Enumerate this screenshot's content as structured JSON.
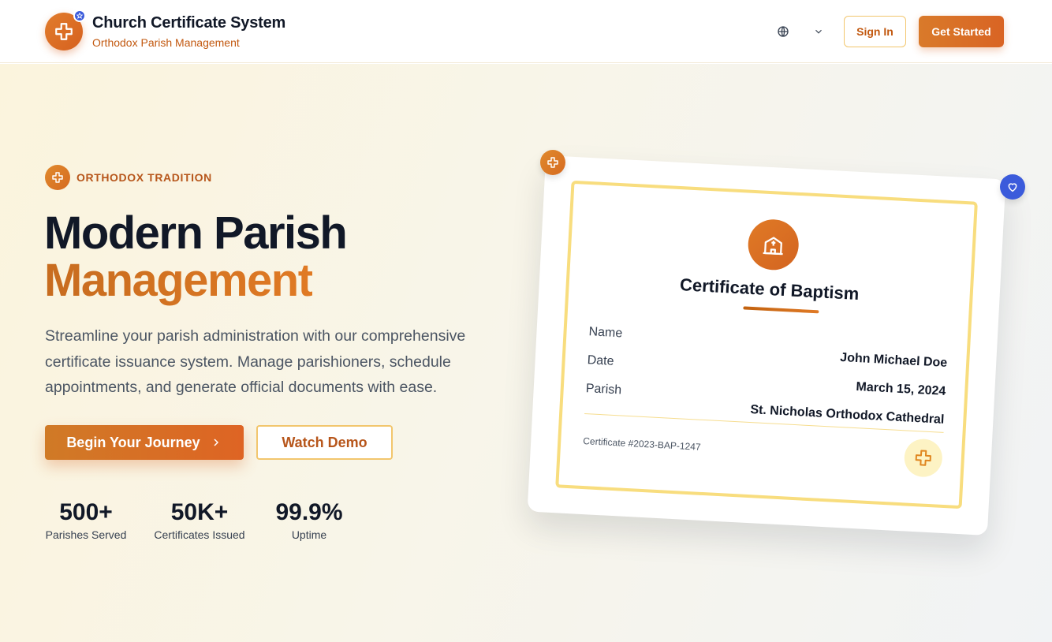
{
  "header": {
    "brand_title": "Church Certificate System",
    "brand_subtitle": "Orthodox Parish Management",
    "sign_in_label": "Sign In",
    "get_started_label": "Get Started"
  },
  "hero": {
    "tag": "ORTHODOX TRADITION",
    "title_line1": "Modern Parish",
    "title_line2": "Management",
    "description": "Streamline your parish administration with our comprehensive certificate issuance system. Manage parishioners, schedule appointments, and generate official documents with ease.",
    "primary_cta": "Begin Your Journey",
    "secondary_cta": "Watch Demo",
    "stats": [
      {
        "value": "500+",
        "label": "Parishes Served"
      },
      {
        "value": "50K+",
        "label": "Certificates Issued"
      },
      {
        "value": "99.9%",
        "label": "Uptime"
      }
    ]
  },
  "certificate": {
    "title": "Certificate of Baptism",
    "fields": [
      {
        "label": "Name",
        "value": "John Michael Doe"
      },
      {
        "label": "Date",
        "value": "March 15, 2024"
      },
      {
        "label": "Parish",
        "value": "St. Nicholas Orthodox Cathedral"
      }
    ],
    "number": "Certificate #2023-BAP-1247"
  },
  "colors": {
    "accent": "#d96424",
    "accent_light": "#f2c66d",
    "badge_blue": "#3b5bdb",
    "heading": "#111827"
  },
  "icons": {
    "logo": "cross-icon",
    "logo_badge": "star-icon",
    "language": "globe-icon",
    "language_dropdown": "chevron-down-icon",
    "cta_arrow": "chevron-right-icon",
    "seal": "church-icon",
    "float_left": "cross-icon",
    "float_right": "heart-icon"
  }
}
